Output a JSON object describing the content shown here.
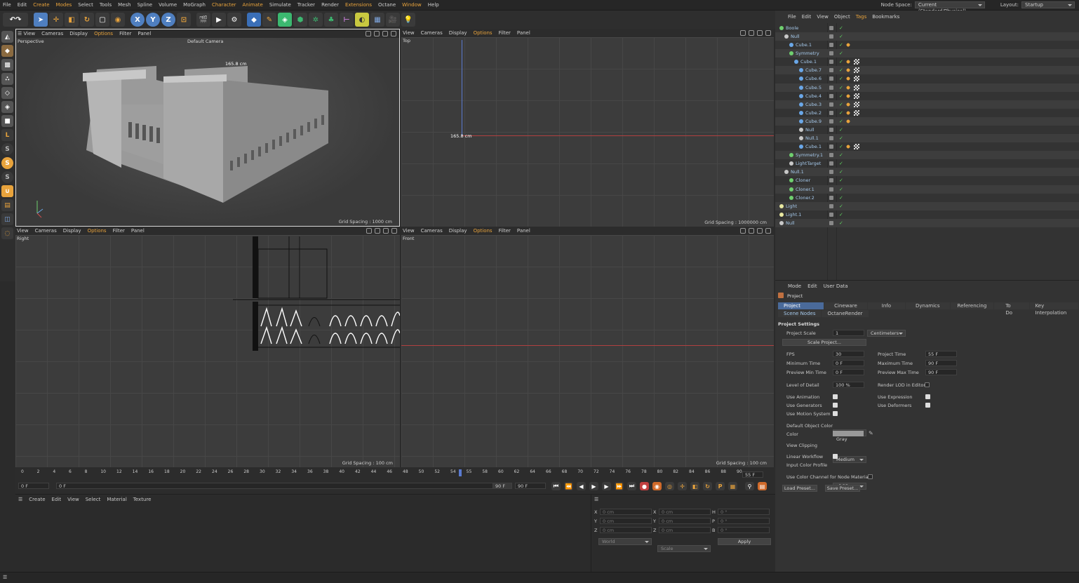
{
  "menubar": {
    "items": [
      "File",
      "Edit",
      "Create",
      "Modes",
      "Select",
      "Tools",
      "Mesh",
      "Spline",
      "Volume",
      "MoGraph",
      "Character",
      "Animate",
      "Simulate",
      "Tracker",
      "Render",
      "Extensions",
      "Octane",
      "Window",
      "Help"
    ],
    "node_space_label": "Node Space:",
    "node_space_value": "Current (Standard/Physical)",
    "layout_label": "Layout:",
    "layout_value": "Startup"
  },
  "viewport_menu": [
    "View",
    "Cameras",
    "Display",
    "Options",
    "Filter",
    "Panel"
  ],
  "viewports": {
    "perspective": {
      "name": "Perspective",
      "camera": "Default Camera",
      "measure": "165.8 cm",
      "grid": "Grid Spacing : 1000 cm"
    },
    "top": {
      "name": "Top",
      "measure": "165.8 cm",
      "grid": "Grid Spacing : 1000000 cm"
    },
    "right": {
      "name": "Right",
      "grid": "Grid Spacing : 100 cm"
    },
    "front": {
      "name": "Front",
      "grid": "Grid Spacing : 100 cm"
    }
  },
  "object_manager": {
    "menu": [
      "File",
      "Edit",
      "View",
      "Object",
      "Tags",
      "Bookmarks"
    ],
    "objects": [
      {
        "name": "Boole",
        "depth": 0,
        "icon": "#6fcf6f"
      },
      {
        "name": "Null",
        "depth": 1,
        "icon": "#c8c8c8"
      },
      {
        "name": "Cube.1",
        "depth": 2,
        "icon": "#6aa7e8"
      },
      {
        "name": "Symmetry",
        "depth": 2,
        "icon": "#6fcf6f"
      },
      {
        "name": "Cube.1",
        "depth": 3,
        "icon": "#6aa7e8"
      },
      {
        "name": "Cube.7",
        "depth": 4,
        "icon": "#6aa7e8"
      },
      {
        "name": "Cube.6",
        "depth": 4,
        "icon": "#6aa7e8"
      },
      {
        "name": "Cube.5",
        "depth": 4,
        "icon": "#6aa7e8"
      },
      {
        "name": "Cube.4",
        "depth": 4,
        "icon": "#6aa7e8"
      },
      {
        "name": "Cube.3",
        "depth": 4,
        "icon": "#6aa7e8"
      },
      {
        "name": "Cube.2",
        "depth": 4,
        "icon": "#6aa7e8"
      },
      {
        "name": "Cube.9",
        "depth": 4,
        "icon": "#6aa7e8"
      },
      {
        "name": "Null",
        "depth": 4,
        "icon": "#c8c8c8"
      },
      {
        "name": "Null.1",
        "depth": 4,
        "icon": "#c8c8c8"
      },
      {
        "name": "Cube.1",
        "depth": 4,
        "icon": "#6aa7e8"
      },
      {
        "name": "Symmetry.1",
        "depth": 2,
        "icon": "#6fcf6f"
      },
      {
        "name": "LightTarget",
        "depth": 2,
        "icon": "#c8c8c8"
      },
      {
        "name": "Null.1",
        "depth": 1,
        "icon": "#c8c8c8"
      },
      {
        "name": "Cloner",
        "depth": 2,
        "icon": "#6fcf6f"
      },
      {
        "name": "Cloner.1",
        "depth": 2,
        "icon": "#6fcf6f"
      },
      {
        "name": "Cloner.2",
        "depth": 2,
        "icon": "#6fcf6f"
      },
      {
        "name": "Light",
        "depth": 0,
        "icon": "#e8e8a0"
      },
      {
        "name": "Light.1",
        "depth": 0,
        "icon": "#e8e8a0"
      },
      {
        "name": "Null",
        "depth": 0,
        "icon": "#c8c8c8"
      }
    ]
  },
  "attributes": {
    "menu": [
      "Mode",
      "Edit",
      "User Data"
    ],
    "title": "Project",
    "tabs": [
      "Project Settings",
      "Cineware",
      "Info",
      "Dynamics",
      "Referencing",
      "To Do",
      "Key Interpolation"
    ],
    "tabs2": [
      "Scene Nodes",
      "OctaneRender"
    ],
    "section": "Project Settings",
    "project_scale_label": "Project Scale",
    "project_scale_value": "1",
    "project_scale_unit": "Centimeters",
    "scale_project_btn": "Scale Project...",
    "fps_label": "FPS",
    "fps": "30",
    "project_time_label": "Project Time",
    "project_time": "55 F",
    "min_time_label": "Minimum Time",
    "min_time": "0 F",
    "max_time_label": "Maximum Time",
    "max_time": "90 F",
    "prev_min_label": "Preview Min Time",
    "prev_min": "0 F",
    "prev_max_label": "Preview Max Time",
    "prev_max": "90 F",
    "lod_label": "Level of Detail",
    "lod": "100 %",
    "render_lod_label": "Render LOD in Editor",
    "use_animation": "Use Animation",
    "use_expression": "Use Expression",
    "use_generators": "Use Generators",
    "use_deformers": "Use Deformers",
    "use_motion": "Use Motion System",
    "def_color_label": "Default Object Color",
    "def_color": "60% Gray",
    "color_label": "Color",
    "view_clip_label": "View Clipping",
    "view_clip": "Medium",
    "linear_label": "Linear Workflow",
    "input_profile_label": "Input Color Profile",
    "input_profile": "sRGB",
    "color_channel_label": "Use Color Channel for Node Material",
    "load_preset": "Load Preset...",
    "save_preset": "Save Preset..."
  },
  "timeline": {
    "ticks": [
      "0",
      "2",
      "4",
      "6",
      "8",
      "10",
      "12",
      "14",
      "16",
      "18",
      "20",
      "22",
      "24",
      "26",
      "28",
      "30",
      "32",
      "34",
      "36",
      "38",
      "40",
      "42",
      "44",
      "46",
      "48",
      "50",
      "52",
      "54",
      "55",
      "58",
      "60",
      "62",
      "64",
      "66",
      "68",
      "70",
      "72",
      "74",
      "76",
      "78",
      "80",
      "82",
      "84",
      "86",
      "88",
      "90"
    ],
    "current": "55 F",
    "start": "0 F",
    "start2": "0 F",
    "end": "90 F",
    "end2": "90 F"
  },
  "material_manager": {
    "menu": [
      "Create",
      "Edit",
      "View",
      "Select",
      "Material",
      "Texture"
    ]
  },
  "coordinates": {
    "rows": [
      {
        "a": "X",
        "av": "0 cm",
        "b": "X",
        "bv": "0 cm",
        "c": "H",
        "cv": "0 °"
      },
      {
        "a": "Y",
        "av": "0 cm",
        "b": "Y",
        "bv": "0 cm",
        "c": "P",
        "cv": "0 °"
      },
      {
        "a": "Z",
        "av": "0 cm",
        "b": "Z",
        "bv": "0 cm",
        "c": "B",
        "cv": "0 °"
      }
    ],
    "mode1": "World",
    "mode2": "Scale",
    "apply": "Apply"
  },
  "colors": {
    "accent": "#e8a33c",
    "selection": "#4a6a9a",
    "object_name": "#a5c8ea",
    "check": "#5fcf5f"
  }
}
